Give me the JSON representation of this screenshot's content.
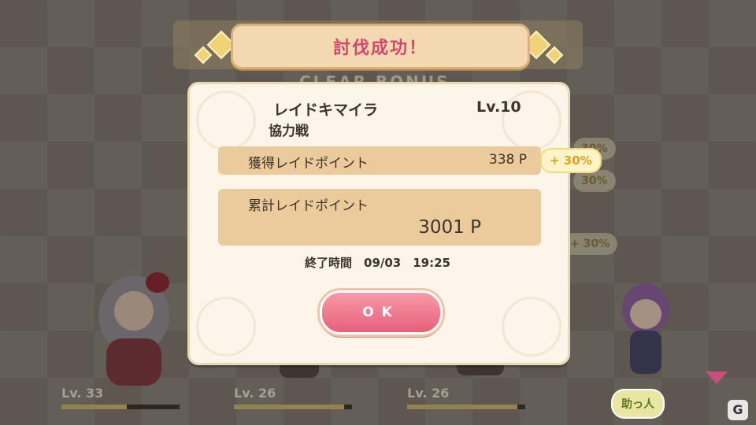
{
  "banner": {
    "title": "討伐成功！"
  },
  "ghost_text": "CLEAR BONUS",
  "result": {
    "boss_name": "レイドキマイラ",
    "boss_level": "Lv.10",
    "mode": "協力戦",
    "earned": {
      "label": "獲得レイドポイント",
      "value": "338 P"
    },
    "total": {
      "label": "累計レイドポイント",
      "value": "3001 P"
    },
    "end_time": "終了時間　09/03　19:25",
    "ok_label": "OK"
  },
  "bonus_badge": "+ 30%",
  "side_badges": [
    "30%",
    "30%",
    "+ 30%"
  ],
  "party": [
    {
      "level": "Lv. 33",
      "hp": 0.55
    },
    {
      "level": "Lv. 26",
      "hp": 0.93
    },
    {
      "level": "Lv. 26",
      "hp": 0.93
    }
  ],
  "help_button": "助っ人",
  "colors": {
    "accent_pink": "#e5607a",
    "title_pink": "#d2476b",
    "bonus_gold": "#e0a21a"
  }
}
